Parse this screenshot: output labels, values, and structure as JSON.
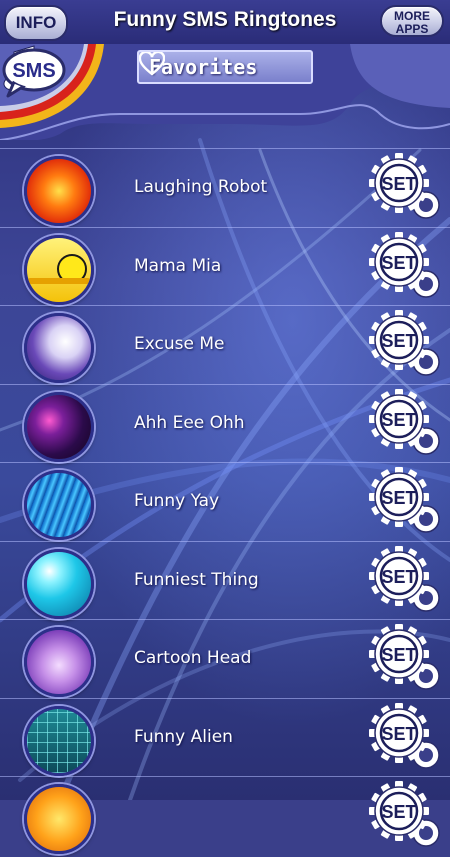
{
  "header": {
    "info_label": "INFO",
    "title": "Funny SMS Ringtones",
    "more_apps_line1": "MORE",
    "more_apps_line2": "APPS"
  },
  "subheader": {
    "favorites_label": "Favorites",
    "sms_label": "SMS"
  },
  "ringtones": [
    {
      "name": "Laughing Robot",
      "thumb": "orange-burst-icon"
    },
    {
      "name": "Mama Mia",
      "thumb": "smiley-icon"
    },
    {
      "name": "Excuse Me",
      "thumb": "purple-splash-icon"
    },
    {
      "name": "Ahh Eee Ohh",
      "thumb": "fireworks-icon"
    },
    {
      "name": "Funny Yay",
      "thumb": "blue-waves-icon"
    },
    {
      "name": "Funniest Thing",
      "thumb": "cyan-bubble-icon"
    },
    {
      "name": "Cartoon Head",
      "thumb": "purple-feather-icon"
    },
    {
      "name": "Funny Alien",
      "thumb": "teal-grid-icon"
    },
    {
      "name": "",
      "thumb": "orange-sun-icon"
    }
  ],
  "set_label": "SET",
  "colors": {
    "header_bg": "#2a2c78",
    "background": "#3a3f8a",
    "accent_red": "#d8231c",
    "accent_yellow": "#f2b51a"
  }
}
